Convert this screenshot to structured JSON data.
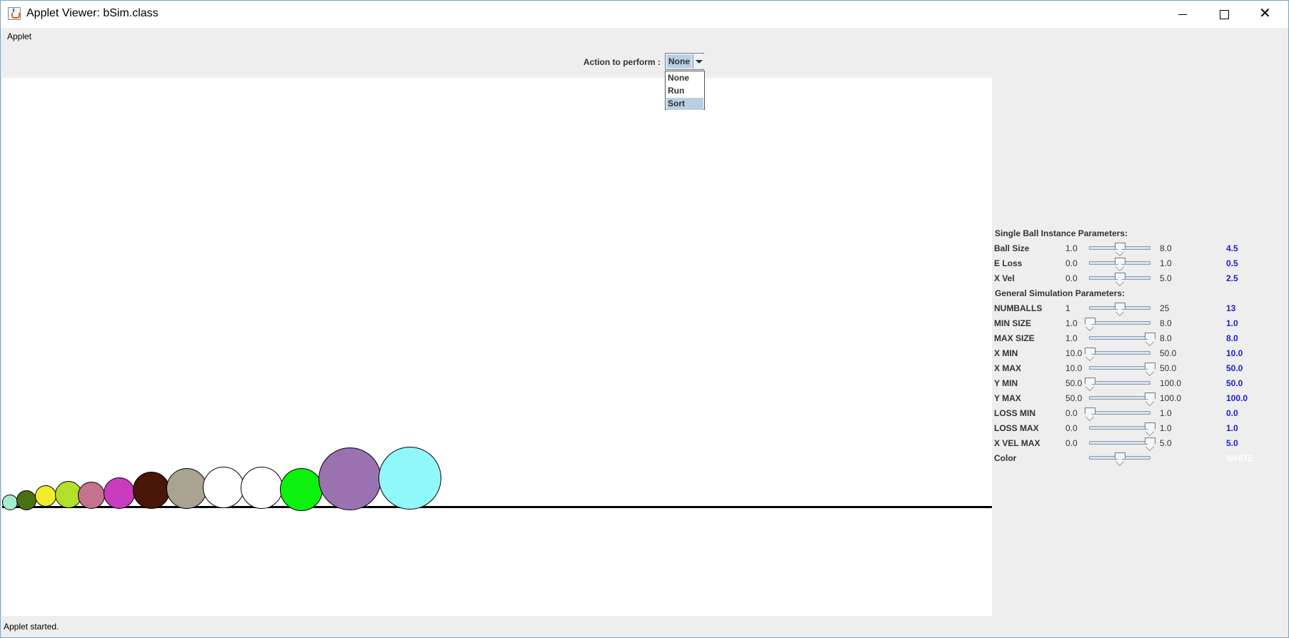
{
  "window": {
    "title": "Applet Viewer: bSim.class"
  },
  "menubar": {
    "items": [
      {
        "label": "Applet"
      }
    ]
  },
  "action": {
    "label": "Action to perform :",
    "selected": "None",
    "options": [
      "None",
      "Run",
      "Sort"
    ],
    "highlighted_option": "Sort"
  },
  "balls": [
    {
      "color": "#a8ecd0"
    },
    {
      "color": "#4a7012"
    },
    {
      "color": "#f2ea2c"
    },
    {
      "color": "#b0e02a"
    },
    {
      "color": "#c47290"
    },
    {
      "color": "#ca3cbe"
    },
    {
      "color": "#4a1608"
    },
    {
      "color": "#a8a490"
    },
    {
      "color": "#ffffff"
    },
    {
      "color": "#ffffff"
    },
    {
      "color": "#0df20d"
    },
    {
      "color": "#9a72b0"
    },
    {
      "color": "#90f8fa"
    }
  ],
  "panel": {
    "single_title": "Single Ball Instance Parameters:",
    "general_title": "General Simulation Parameters:",
    "single_params": [
      {
        "name": "Ball Size",
        "min": "1.0",
        "max": "8.0",
        "value": "4.5",
        "fraction": 0.5
      },
      {
        "name": "E Loss",
        "min": "0.0",
        "max": "1.0",
        "value": "0.5",
        "fraction": 0.5
      },
      {
        "name": "X Vel",
        "min": "0.0",
        "max": "5.0",
        "value": "2.5",
        "fraction": 0.5
      }
    ],
    "general_params": [
      {
        "name": "NUMBALLS",
        "min": "1",
        "max": "25",
        "value": "13",
        "fraction": 0.5
      },
      {
        "name": "MIN SIZE",
        "min": "1.0",
        "max": "8.0",
        "value": "1.0",
        "fraction": 0.0
      },
      {
        "name": "MAX SIZE",
        "min": "1.0",
        "max": "8.0",
        "value": "8.0",
        "fraction": 1.0
      },
      {
        "name": "X MIN",
        "min": "10.0",
        "max": "50.0",
        "value": "10.0",
        "fraction": 0.0
      },
      {
        "name": "X MAX",
        "min": "10.0",
        "max": "50.0",
        "value": "50.0",
        "fraction": 1.0
      },
      {
        "name": "Y MIN",
        "min": "50.0",
        "max": "100.0",
        "value": "50.0",
        "fraction": 0.0
      },
      {
        "name": "Y MAX",
        "min": "50.0",
        "max": "100.0",
        "value": "100.0",
        "fraction": 1.0
      },
      {
        "name": "LOSS MIN",
        "min": "0.0",
        "max": "1.0",
        "value": "0.0",
        "fraction": 0.0
      },
      {
        "name": "LOSS MAX",
        "min": "0.0",
        "max": "1.0",
        "value": "1.0",
        "fraction": 1.0
      },
      {
        "name": "X VEL MAX",
        "min": "0.0",
        "max": "5.0",
        "value": "5.0",
        "fraction": 1.0
      },
      {
        "name": "Color",
        "min": "",
        "max": "",
        "value": "WHITE",
        "fraction": 0.5,
        "value_color": "#ffffff"
      }
    ]
  },
  "status": {
    "text": "Applet started."
  }
}
